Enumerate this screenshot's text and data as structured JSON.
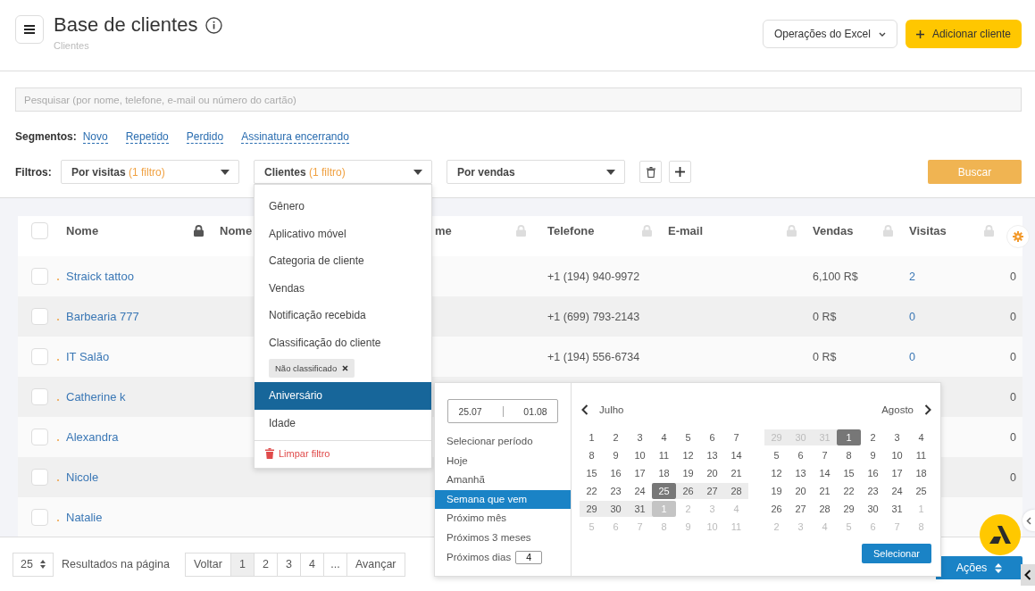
{
  "header": {
    "title": "Base de clientes",
    "subtitle": "Clientes",
    "excel_button": "Operações do Excel",
    "add_button": "Adicionar cliente"
  },
  "search": {
    "placeholder": "Pesquisar (por nome, telefone, e-mail ou número do cartão)"
  },
  "segments": {
    "label": "Segmentos:",
    "links": [
      "Novo",
      "Repetido",
      "Perdido",
      "Assinatura encerrando"
    ]
  },
  "filters": {
    "label": "Filtros:",
    "selects": [
      {
        "label": "Por visitas",
        "count": "(1 filtro)",
        "open": false
      },
      {
        "label": "Clientes",
        "count": "(1 filtro)",
        "open": true
      },
      {
        "label": "Por vendas",
        "open": false
      }
    ],
    "search_button": "Buscar"
  },
  "filter_menu": {
    "items": [
      {
        "label": "Gênero",
        "selected": false
      },
      {
        "label": "Aplicativo móvel",
        "selected": false
      },
      {
        "label": "Categoria de cliente",
        "selected": false
      },
      {
        "label": "Vendas",
        "selected": false
      },
      {
        "label": "Notificação recebida",
        "selected": false
      },
      {
        "label": "Classificação do cliente",
        "selected": false,
        "tags": [
          "Não classificado"
        ]
      },
      {
        "label": "Aniversário",
        "selected": true
      },
      {
        "label": "Idade",
        "selected": false
      }
    ],
    "clear": "Limpar filtro"
  },
  "date_picker": {
    "range_start": "25.07",
    "range_end": "01.08",
    "presets": [
      {
        "label": "Selecionar período",
        "selected": false
      },
      {
        "label": "Hoje",
        "selected": false
      },
      {
        "label": "Amanhã",
        "selected": false
      },
      {
        "label": "Semana que vem",
        "selected": true
      },
      {
        "label": "Próximo mês",
        "selected": false
      },
      {
        "label": "Próximos 3 meses",
        "selected": false
      }
    ],
    "next_days": {
      "label": "Próximos dias",
      "value": "4"
    },
    "months": [
      {
        "name": "Julho",
        "days": [
          {
            "d": "1",
            "other": false,
            "in_range": false,
            "selected": false
          },
          {
            "d": "2",
            "other": false,
            "in_range": false,
            "selected": false
          },
          {
            "d": "3",
            "other": false,
            "in_range": false,
            "selected": false
          },
          {
            "d": "4",
            "other": false,
            "in_range": false,
            "selected": false
          },
          {
            "d": "5",
            "other": false,
            "in_range": false,
            "selected": false
          },
          {
            "d": "6",
            "other": false,
            "in_range": false,
            "selected": false
          },
          {
            "d": "7",
            "other": false,
            "in_range": false,
            "selected": false
          },
          {
            "d": "8",
            "other": false,
            "in_range": false,
            "selected": false
          },
          {
            "d": "9",
            "other": false,
            "in_range": false,
            "selected": false
          },
          {
            "d": "10",
            "other": false,
            "in_range": false,
            "selected": false
          },
          {
            "d": "11",
            "other": false,
            "in_range": false,
            "selected": false
          },
          {
            "d": "12",
            "other": false,
            "in_range": false,
            "selected": false
          },
          {
            "d": "13",
            "other": false,
            "in_range": false,
            "selected": false
          },
          {
            "d": "14",
            "other": false,
            "in_range": false,
            "selected": false
          },
          {
            "d": "15",
            "other": false,
            "in_range": false,
            "selected": false
          },
          {
            "d": "16",
            "other": false,
            "in_range": false,
            "selected": false
          },
          {
            "d": "17",
            "other": false,
            "in_range": false,
            "selected": false
          },
          {
            "d": "18",
            "other": false,
            "in_range": false,
            "selected": false
          },
          {
            "d": "19",
            "other": false,
            "in_range": false,
            "selected": false
          },
          {
            "d": "20",
            "other": false,
            "in_range": false,
            "selected": false
          },
          {
            "d": "21",
            "other": false,
            "in_range": false,
            "selected": false
          },
          {
            "d": "22",
            "other": false,
            "in_range": false,
            "selected": false
          },
          {
            "d": "23",
            "other": false,
            "in_range": false,
            "selected": false
          },
          {
            "d": "24",
            "other": false,
            "in_range": false,
            "selected": false
          },
          {
            "d": "25",
            "other": false,
            "in_range": true,
            "selected": true
          },
          {
            "d": "26",
            "other": false,
            "in_range": true,
            "selected": false
          },
          {
            "d": "27",
            "other": false,
            "in_range": true,
            "selected": false
          },
          {
            "d": "28",
            "other": false,
            "in_range": true,
            "selected": false
          },
          {
            "d": "29",
            "other": false,
            "in_range": true,
            "selected": false
          },
          {
            "d": "30",
            "other": false,
            "in_range": true,
            "selected": false
          },
          {
            "d": "31",
            "other": false,
            "in_range": true,
            "selected": false
          },
          {
            "d": "1",
            "other": true,
            "in_range": true,
            "selected": true
          },
          {
            "d": "2",
            "other": true,
            "in_range": false,
            "selected": false
          },
          {
            "d": "3",
            "other": true,
            "in_range": false,
            "selected": false
          },
          {
            "d": "4",
            "other": true,
            "in_range": false,
            "selected": false
          },
          {
            "d": "5",
            "other": true,
            "in_range": false,
            "selected": false
          },
          {
            "d": "6",
            "other": true,
            "in_range": false,
            "selected": false
          },
          {
            "d": "7",
            "other": true,
            "in_range": false,
            "selected": false
          },
          {
            "d": "8",
            "other": true,
            "in_range": false,
            "selected": false
          },
          {
            "d": "9",
            "other": true,
            "in_range": false,
            "selected": false
          },
          {
            "d": "10",
            "other": true,
            "in_range": false,
            "selected": false
          },
          {
            "d": "11",
            "other": true,
            "in_range": false,
            "selected": false
          }
        ]
      },
      {
        "name": "Agosto",
        "days": [
          {
            "d": "29",
            "other": true,
            "in_range": true,
            "selected": false
          },
          {
            "d": "30",
            "other": true,
            "in_range": true,
            "selected": false
          },
          {
            "d": "31",
            "other": true,
            "in_range": true,
            "selected": false
          },
          {
            "d": "1",
            "other": false,
            "in_range": true,
            "selected": true
          },
          {
            "d": "2",
            "other": false,
            "in_range": false,
            "selected": false
          },
          {
            "d": "3",
            "other": false,
            "in_range": false,
            "selected": false
          },
          {
            "d": "4",
            "other": false,
            "in_range": false,
            "selected": false
          },
          {
            "d": "5",
            "other": false,
            "in_range": false,
            "selected": false
          },
          {
            "d": "6",
            "other": false,
            "in_range": false,
            "selected": false
          },
          {
            "d": "7",
            "other": false,
            "in_range": false,
            "selected": false
          },
          {
            "d": "8",
            "other": false,
            "in_range": false,
            "selected": false
          },
          {
            "d": "9",
            "other": false,
            "in_range": false,
            "selected": false
          },
          {
            "d": "10",
            "other": false,
            "in_range": false,
            "selected": false
          },
          {
            "d": "11",
            "other": false,
            "in_range": false,
            "selected": false
          },
          {
            "d": "12",
            "other": false,
            "in_range": false,
            "selected": false
          },
          {
            "d": "13",
            "other": false,
            "in_range": false,
            "selected": false
          },
          {
            "d": "14",
            "other": false,
            "in_range": false,
            "selected": false
          },
          {
            "d": "15",
            "other": false,
            "in_range": false,
            "selected": false
          },
          {
            "d": "16",
            "other": false,
            "in_range": false,
            "selected": false
          },
          {
            "d": "17",
            "other": false,
            "in_range": false,
            "selected": false
          },
          {
            "d": "18",
            "other": false,
            "in_range": false,
            "selected": false
          },
          {
            "d": "19",
            "other": false,
            "in_range": false,
            "selected": false
          },
          {
            "d": "20",
            "other": false,
            "in_range": false,
            "selected": false
          },
          {
            "d": "21",
            "other": false,
            "in_range": false,
            "selected": false
          },
          {
            "d": "22",
            "other": false,
            "in_range": false,
            "selected": false
          },
          {
            "d": "23",
            "other": false,
            "in_range": false,
            "selected": false
          },
          {
            "d": "24",
            "other": false,
            "in_range": false,
            "selected": false
          },
          {
            "d": "25",
            "other": false,
            "in_range": false,
            "selected": false
          },
          {
            "d": "26",
            "other": false,
            "in_range": false,
            "selected": false
          },
          {
            "d": "27",
            "other": false,
            "in_range": false,
            "selected": false
          },
          {
            "d": "28",
            "other": false,
            "in_range": false,
            "selected": false
          },
          {
            "d": "29",
            "other": false,
            "in_range": false,
            "selected": false
          },
          {
            "d": "30",
            "other": false,
            "in_range": false,
            "selected": false
          },
          {
            "d": "31",
            "other": false,
            "in_range": false,
            "selected": false
          },
          {
            "d": "1",
            "other": true,
            "in_range": false,
            "selected": false
          },
          {
            "d": "2",
            "other": true,
            "in_range": false,
            "selected": false
          },
          {
            "d": "3",
            "other": true,
            "in_range": false,
            "selected": false
          },
          {
            "d": "4",
            "other": true,
            "in_range": false,
            "selected": false
          },
          {
            "d": "5",
            "other": true,
            "in_range": false,
            "selected": false
          },
          {
            "d": "6",
            "other": true,
            "in_range": false,
            "selected": false
          },
          {
            "d": "7",
            "other": true,
            "in_range": false,
            "selected": false
          },
          {
            "d": "8",
            "other": true,
            "in_range": false,
            "selected": false
          }
        ]
      }
    ],
    "select_button": "Selecionar"
  },
  "table": {
    "select_all_checked": false,
    "columns": [
      {
        "label": "Nome",
        "locked": true
      },
      {
        "label": "Nome"
      },
      {
        "label": "me",
        "locked": false
      },
      {
        "label": "Telefone",
        "locked": false
      },
      {
        "label": "E-mail",
        "locked": false
      },
      {
        "label": "Vendas",
        "locked": false
      },
      {
        "label": "Visitas",
        "locked": false
      }
    ],
    "rows": [
      {
        "checked": false,
        "name": "Straick tattoo",
        "phone": "+1 (194) 940-9972",
        "sales": "6,100 R$",
        "visits": "2",
        "column_8": "0"
      },
      {
        "checked": false,
        "name": "Barbearia 777",
        "phone": "+1 (699) 793-2143",
        "sales": "0 R$",
        "visits": "0",
        "column_8": "0"
      },
      {
        "checked": false,
        "name": "IT Salão",
        "phone": "+1 (194) 556-6734",
        "sales": "0 R$",
        "visits": "0",
        "column_8": "0"
      },
      {
        "checked": false,
        "name": "Catherine k",
        "column_8": "0"
      },
      {
        "checked": false,
        "name": "Alexandra",
        "column_8": "0"
      },
      {
        "checked": false,
        "name": "Nicole",
        "column_8": "0"
      },
      {
        "checked": false,
        "name": "Natalie"
      }
    ]
  },
  "footer": {
    "per_page": "25",
    "per_page_label": "Resultados na página",
    "prev": "Voltar",
    "pages": [
      {
        "label": "1",
        "selected": true
      },
      {
        "label": "2",
        "selected": false
      },
      {
        "label": "3",
        "selected": false
      },
      {
        "label": "4",
        "selected": false
      },
      {
        "label": "...",
        "selected": false
      }
    ],
    "next": "Avançar",
    "actions_button": "Ações"
  }
}
